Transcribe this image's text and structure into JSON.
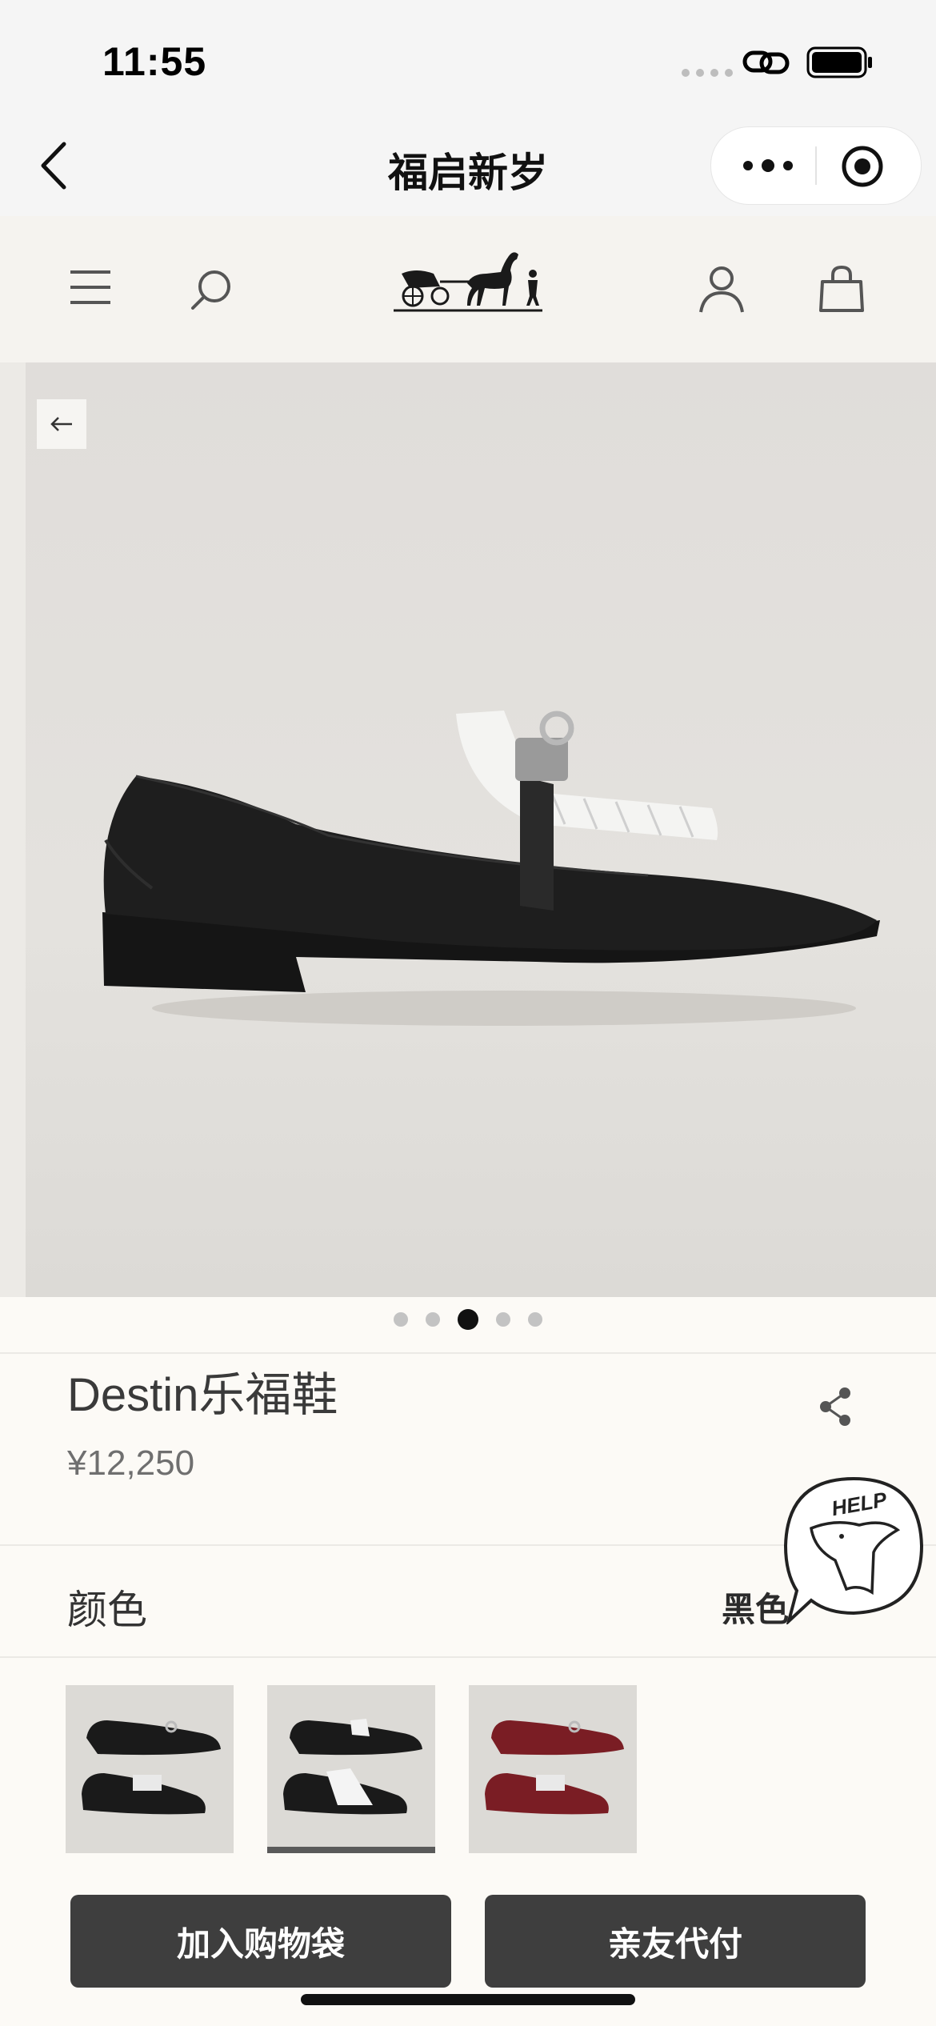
{
  "status_bar": {
    "time": "11:55"
  },
  "mini_program": {
    "title": "福启新岁"
  },
  "product": {
    "name": "Destin乐福鞋",
    "price": "¥12,250",
    "color_label": "颜色",
    "color_value": "黑色",
    "gallery": {
      "image_count": 5,
      "active_index": 2
    },
    "swatches": [
      {
        "color_name": "black",
        "hex": "#1c1c1c",
        "selected": false
      },
      {
        "color_name": "black-white-fringe",
        "hex": "#1c1c1c",
        "selected": true
      },
      {
        "color_name": "burgundy",
        "hex": "#7a1d24",
        "selected": false
      }
    ]
  },
  "help_badge": {
    "text": "HELP"
  },
  "actions": {
    "add_to_bag": "加入购物袋",
    "friend_pay": "亲友代付"
  },
  "colors": {
    "button_bg": "#3e3e3e",
    "page_bg": "#fcfaf6",
    "header_bg": "#f5f3ef"
  }
}
